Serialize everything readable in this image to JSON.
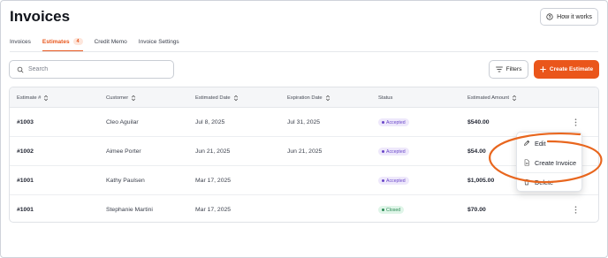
{
  "header": {
    "title": "Invoices",
    "how_it_works_label": "How it works"
  },
  "tabs": [
    {
      "label": "Invoices",
      "active": false
    },
    {
      "label": "Estimates",
      "active": true,
      "badge": "4"
    },
    {
      "label": "Credit Memo",
      "active": false
    },
    {
      "label": "Invoice Settings",
      "active": false
    }
  ],
  "toolbar": {
    "search_placeholder": "Search",
    "filters_label": "Filters",
    "create_label": "Create Estimate"
  },
  "table": {
    "columns": [
      "Estimate #",
      "Customer",
      "Estimated Date",
      "Expiration Date",
      "Status",
      "Estimated Amount"
    ],
    "rows": [
      {
        "id": "#1003",
        "customer": "Cleo Aguilar",
        "estimated_date": "Jul 8, 2025",
        "expiration_date": "Jul 31, 2025",
        "status": "Accepted",
        "amount": "$540.00"
      },
      {
        "id": "#1002",
        "customer": "Aimee Porter",
        "estimated_date": "Jun 21, 2025",
        "expiration_date": "Jun 21, 2025",
        "status": "Accepted",
        "amount": "$54.00"
      },
      {
        "id": "#1001",
        "customer": "Kathy Paulsen",
        "estimated_date": "Mar 17, 2025",
        "expiration_date": "",
        "status": "Accepted",
        "amount": "$1,005.00"
      },
      {
        "id": "#1001",
        "customer": "Stephanie Martini",
        "estimated_date": "Mar 17, 2025",
        "expiration_date": "",
        "status": "Closed",
        "amount": "$70.00"
      }
    ]
  },
  "row_menu": {
    "items": [
      "Edit",
      "Create Invoice",
      "Delete"
    ]
  },
  "colors": {
    "accent": "#ea561b",
    "accepted": "#6a47c9",
    "closed": "#2c8a55",
    "annotation": "#e8661e"
  },
  "icons": [
    "question-circle-icon",
    "search-icon",
    "filter-icon",
    "plus-icon",
    "sort-icon",
    "kebab-icon",
    "pencil-icon",
    "document-icon",
    "trash-icon"
  ]
}
